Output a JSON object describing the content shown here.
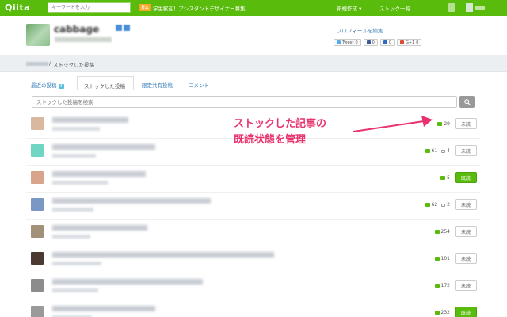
{
  "header": {
    "logo": "Qiita",
    "search_placeholder": "キーワードを入力",
    "promo_badge": "募集",
    "promo_text": "学生歓迎！アシスタントデザイナー募集",
    "nav_new": "新規作成 ▾",
    "nav_stock": "ストック一覧"
  },
  "profile": {
    "name": "cabbage",
    "edit_link": "プロフィールを編集",
    "share": [
      {
        "label": "Tweet",
        "count": "0",
        "color": "#55acee",
        "icon": "twitter-icon"
      },
      {
        "label": "",
        "count": "0",
        "color": "#3b5998",
        "icon": "facebook-icon"
      },
      {
        "label": "",
        "count": "0",
        "color": "#2e6bc4",
        "icon": "hatena-icon"
      },
      {
        "label": "G+1",
        "count": "0",
        "color": "#dd4b39",
        "icon": "gplus-icon"
      }
    ]
  },
  "breadcrumb": {
    "separator": "/",
    "current": "ストックした投稿"
  },
  "tabs": [
    {
      "label": "最近の投稿",
      "count": "4",
      "active": false
    },
    {
      "label": "ストックした投稿",
      "active": true
    },
    {
      "label": "限定共有投稿",
      "active": false
    },
    {
      "label": "コメント",
      "active": false
    }
  ],
  "filter": {
    "placeholder": "ストックした投稿を検索",
    "button_icon": "search-icon"
  },
  "items": [
    {
      "stocks": "29",
      "comments": "",
      "status": "未読",
      "read": false,
      "avatar_color": "#d9b8a0"
    },
    {
      "stocks": "61",
      "comments": "4",
      "status": "未読",
      "read": false,
      "avatar_color": "#6fd6c4"
    },
    {
      "stocks": "5",
      "comments": "",
      "status": "既読",
      "read": true,
      "avatar_color": "#d8a58c"
    },
    {
      "stocks": "62",
      "comments": "2",
      "status": "未読",
      "read": false,
      "avatar_color": "#7a98c4"
    },
    {
      "stocks": "254",
      "comments": "",
      "status": "未読",
      "read": false,
      "avatar_color": "#a39078"
    },
    {
      "stocks": "101",
      "comments": "",
      "status": "未読",
      "read": false,
      "avatar_color": "#4a3a32"
    },
    {
      "stocks": "172",
      "comments": "",
      "status": "未読",
      "read": false,
      "avatar_color": "#8c8c8c"
    },
    {
      "stocks": "232",
      "comments": "",
      "status": "既読",
      "read": true,
      "avatar_color": "#9a9a9a"
    }
  ],
  "annotation": {
    "line1": "ストックした記事の",
    "line2": "既読状態を管理",
    "color": "#e8336e"
  },
  "colors": {
    "brand": "#59bb0c",
    "link": "#337ab7"
  }
}
